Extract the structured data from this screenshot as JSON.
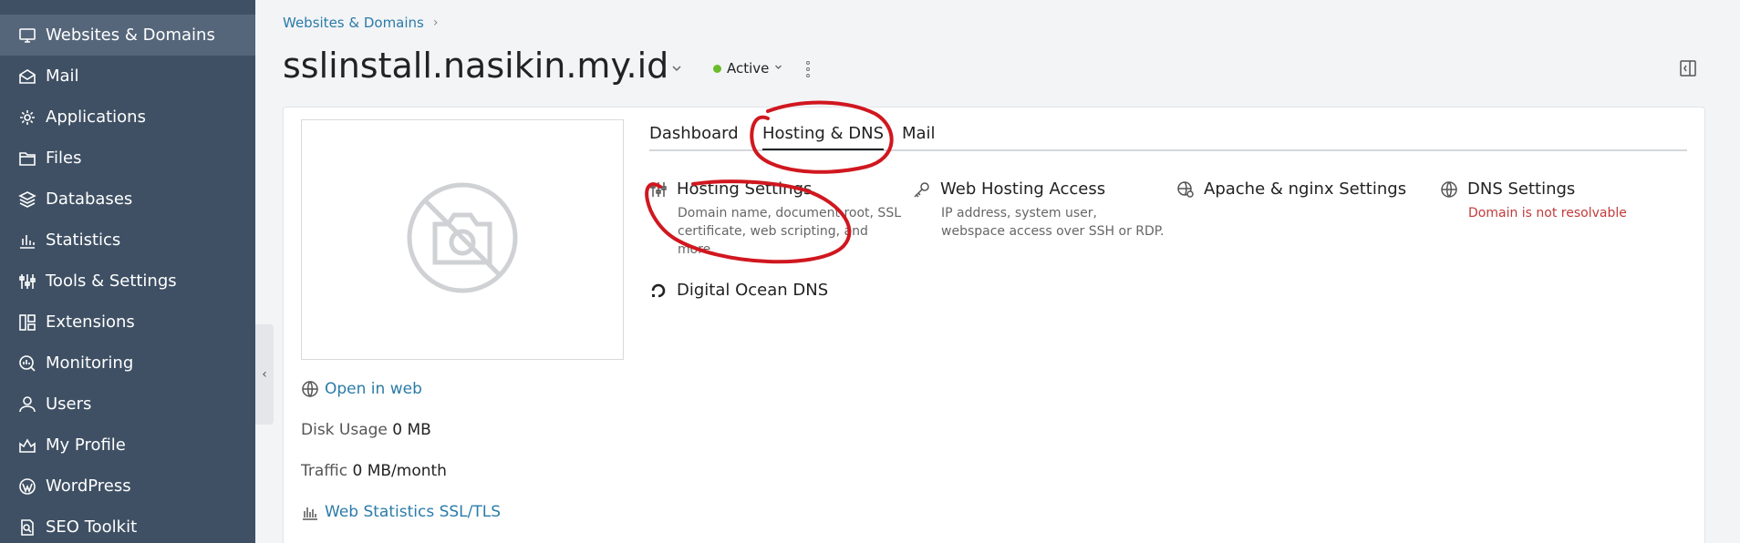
{
  "sidebar": {
    "items": [
      {
        "label": "Websites & Domains",
        "icon": "monitor-icon",
        "active": true
      },
      {
        "label": "Mail",
        "icon": "mail-icon"
      },
      {
        "label": "Applications",
        "icon": "gear-icon"
      },
      {
        "label": "Files",
        "icon": "folder-icon"
      },
      {
        "label": "Databases",
        "icon": "database-icon"
      },
      {
        "label": "Statistics",
        "icon": "bar-chart-icon"
      },
      {
        "label": "Tools & Settings",
        "icon": "sliders-icon"
      },
      {
        "label": "Extensions",
        "icon": "extensions-icon"
      },
      {
        "label": "Monitoring",
        "icon": "monitoring-icon"
      },
      {
        "label": "Users",
        "icon": "user-icon"
      },
      {
        "label": "My Profile",
        "icon": "profile-icon"
      },
      {
        "label": "WordPress",
        "icon": "wordpress-icon"
      },
      {
        "label": "SEO Toolkit",
        "icon": "seo-icon"
      }
    ],
    "collapse_glyph": "‹"
  },
  "header": {
    "breadcrumb": "Websites & Domains",
    "breadcrumb_sep": "›",
    "title": "sslinstall.nasikin.my.id",
    "status": "Active",
    "status_color": "#6bbb2b"
  },
  "side": {
    "open_in_web": "Open in web",
    "disk_usage_label": "Disk Usage",
    "disk_usage_value": "0 MB",
    "traffic_label": "Traffic",
    "traffic_value": "0 MB/month",
    "web_stats": "Web Statistics SSL/TLS"
  },
  "tabs": [
    {
      "label": "Dashboard"
    },
    {
      "label": "Hosting & DNS",
      "active": true
    },
    {
      "label": "Mail"
    }
  ],
  "tiles": [
    {
      "title": "Hosting Settings",
      "desc": "Domain name, document root, SSL certificate, web scripting, and more.",
      "icon": "sliders-icon"
    },
    {
      "title": "Web Hosting Access",
      "desc": "IP address, system user, webspace access over SSH or RDP.",
      "icon": "key-icon"
    },
    {
      "title": "Apache & nginx Settings",
      "desc": "",
      "icon": "globe-gear-icon"
    },
    {
      "title": "DNS Settings",
      "desc": "Domain is not resolvable",
      "icon": "globe-icon",
      "error": true
    },
    {
      "title": "Digital Ocean DNS",
      "desc": "",
      "icon": "digitalocean-icon"
    }
  ],
  "colors": {
    "sidebar_bg": "#3f5064",
    "link": "#2a7ba8",
    "error": "#c23a3a",
    "annotation": "#d0171f"
  }
}
